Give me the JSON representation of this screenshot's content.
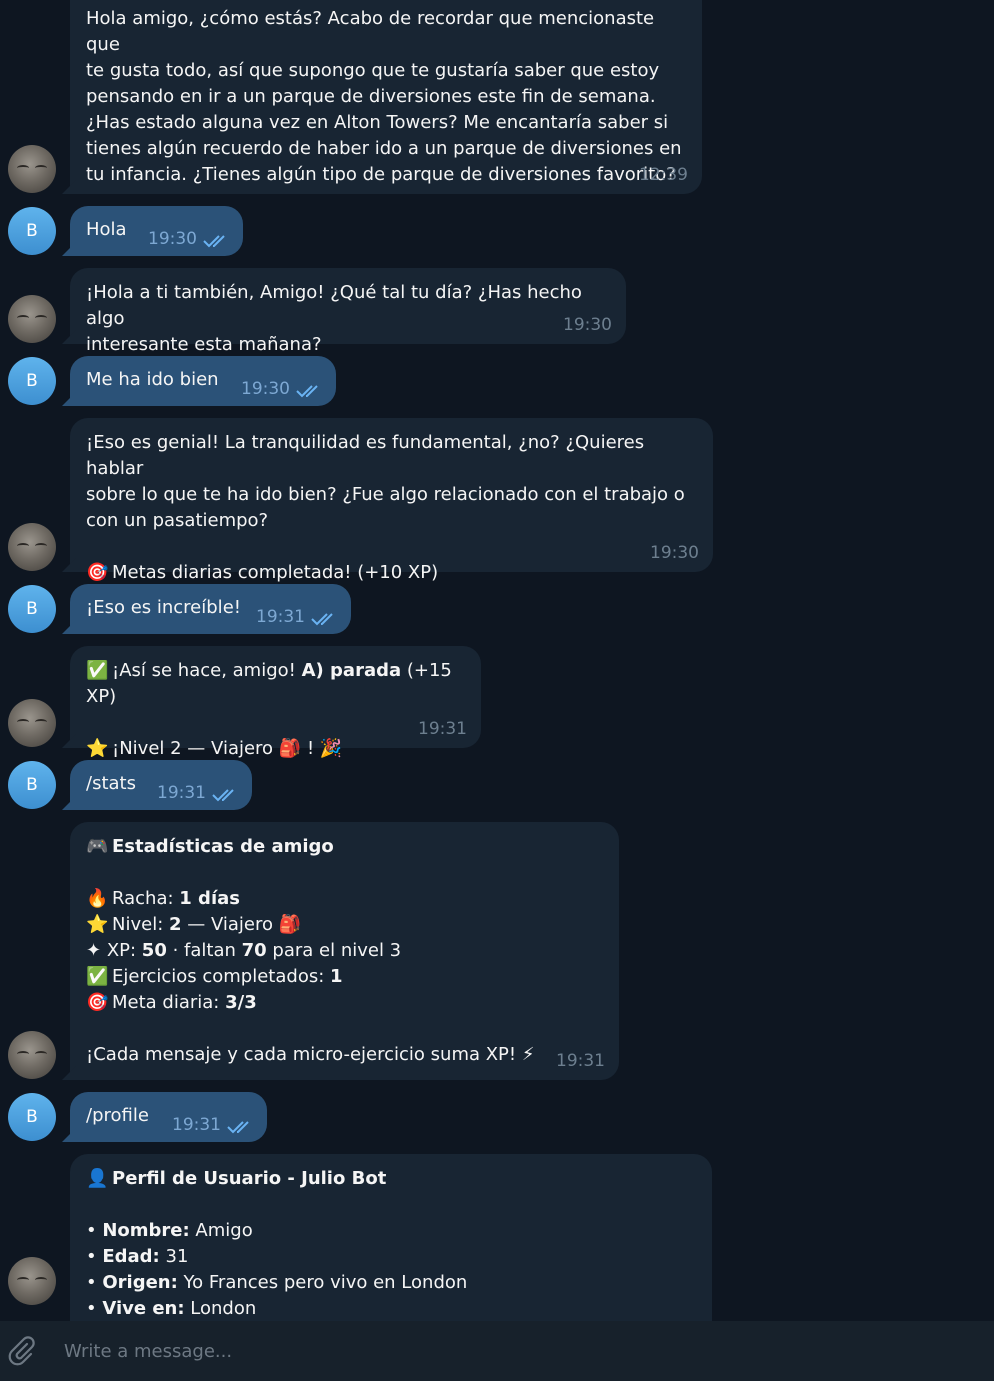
{
  "messages": [
    {
      "from": "bot",
      "text": "Hola amigo, ¿cómo estás? Acabo de recordar que mencionaste que\nte gusta todo, así que supongo que te gustaría saber que estoy\npensando en ir a un parque de diversiones este fin de semana.\n¿Has estado alguna vez en Alton Towers? Me encantaría saber si\ntienes algún recuerdo de haber ido a un parque de diversiones en\ntu infancia. ¿Tienes algún tipo de parque de diversiones favorito?",
      "time": "12:39"
    },
    {
      "from": "user",
      "avatar_letter": "B",
      "text": "Hola",
      "time": "19:30"
    },
    {
      "from": "bot",
      "text": "¡Hola a ti también, Amigo! ¿Qué tal tu día? ¿Has hecho algo\ninteresante esta mañana?",
      "time": "19:30"
    },
    {
      "from": "user",
      "avatar_letter": "B",
      "text": "Me ha ido bien",
      "time": "19:30"
    },
    {
      "from": "bot",
      "text": "¡Eso es genial! La tranquilidad es fundamental, ¿no? ¿Quieres hablar\nsobre lo que te ha ido bien? ¿Fue algo relacionado con el trabajo o\ncon un pasatiempo?",
      "goal_emoji": "🎯",
      "goal_text": "Metas diarias completada! (+10 XP)",
      "time": "19:30"
    },
    {
      "from": "user",
      "avatar_letter": "B",
      "text": "¡Eso es increíble!",
      "time": "19:31"
    },
    {
      "from": "bot",
      "check_emoji": "✅",
      "line1_pre": "¡Así se hace, amigo! ",
      "line1_bold": "A) parada",
      "line1_post": " (+15 XP)",
      "star_emoji": "⭐",
      "line2": "¡Nivel 2 — Viajero",
      "bag_emoji": "🎒",
      "line2_end": "!",
      "party_emoji": "🎉",
      "time": "19:31"
    },
    {
      "from": "user",
      "avatar_letter": "B",
      "text": "/stats",
      "time": "19:31"
    },
    {
      "from": "bot",
      "title_emoji": "🎮",
      "title": "Estadísticas de amigo",
      "racha_emoji": "🔥",
      "racha_label": "Racha: ",
      "racha_value": "1 días",
      "nivel_emoji": "⭐",
      "nivel_label": "Nivel: ",
      "nivel_value": "2",
      "nivel_rest": " — Viajero",
      "nivel_bag": "🎒",
      "xp_emoji": "✦",
      "xp_label": " XP: ",
      "xp_value": "50",
      "xp_mid": " · faltan ",
      "xp_need": "70",
      "xp_end": " para el nivel 3",
      "ej_emoji": "✅",
      "ej_label": "Ejercicios completados: ",
      "ej_value": "1",
      "meta_emoji": "🎯",
      "meta_label": "Meta diaria: ",
      "meta_value": "3/3",
      "footer": "¡Cada mensaje y cada micro-ejercicio suma XP! ",
      "footer_emoji": "⚡",
      "time": "19:31"
    },
    {
      "from": "user",
      "avatar_letter": "B",
      "text": "/profile",
      "time": "19:31"
    },
    {
      "from": "bot",
      "title_emoji": "👤",
      "title": "Perfil de Usuario - Julio Bot",
      "fields": [
        {
          "label": "Nombre:",
          "value": " Amigo"
        },
        {
          "label": "Edad:",
          "value": " 31"
        },
        {
          "label": "Origen:",
          "value": " Yo Frances pero vivo en London"
        },
        {
          "label": "Vive en:",
          "value": " London"
        }
      ]
    }
  ],
  "composer": {
    "placeholder": "Write a message..."
  },
  "icons": {
    "attach": "paperclip-icon",
    "read_receipt": "double-check-icon"
  },
  "colors": {
    "background": "#0e1621",
    "incoming": "#182533",
    "outgoing": "#2b5278",
    "accent": "#4ea4f6"
  }
}
